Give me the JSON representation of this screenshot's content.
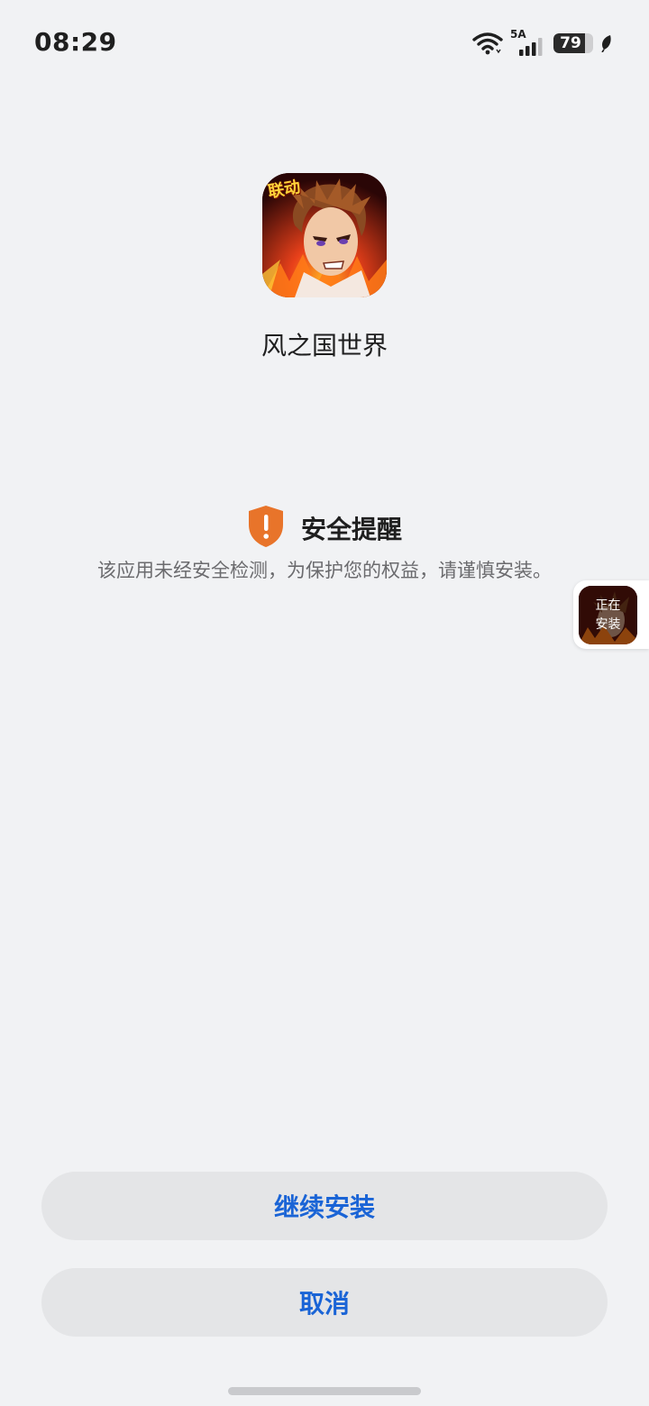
{
  "status_bar": {
    "time": "08:29",
    "network_label": "5A",
    "battery_level": 79,
    "battery_text": "79",
    "icons": [
      "wifi-icon",
      "signal-icon",
      "battery-icon",
      "leaf-icon"
    ]
  },
  "app": {
    "name": "风之国世界",
    "icon_badge": "联动"
  },
  "security": {
    "icon": "shield-warning-icon",
    "title": "安全提醒",
    "message": "该应用未经安全检测，为保护您的权益，请谨慎安装。",
    "accent_color": "#e8742a"
  },
  "floating_widget": {
    "line1": "正在",
    "line2": "安装"
  },
  "buttons": {
    "continue_label": "继续安装",
    "cancel_label": "取消",
    "label_color": "#1a64d6"
  }
}
